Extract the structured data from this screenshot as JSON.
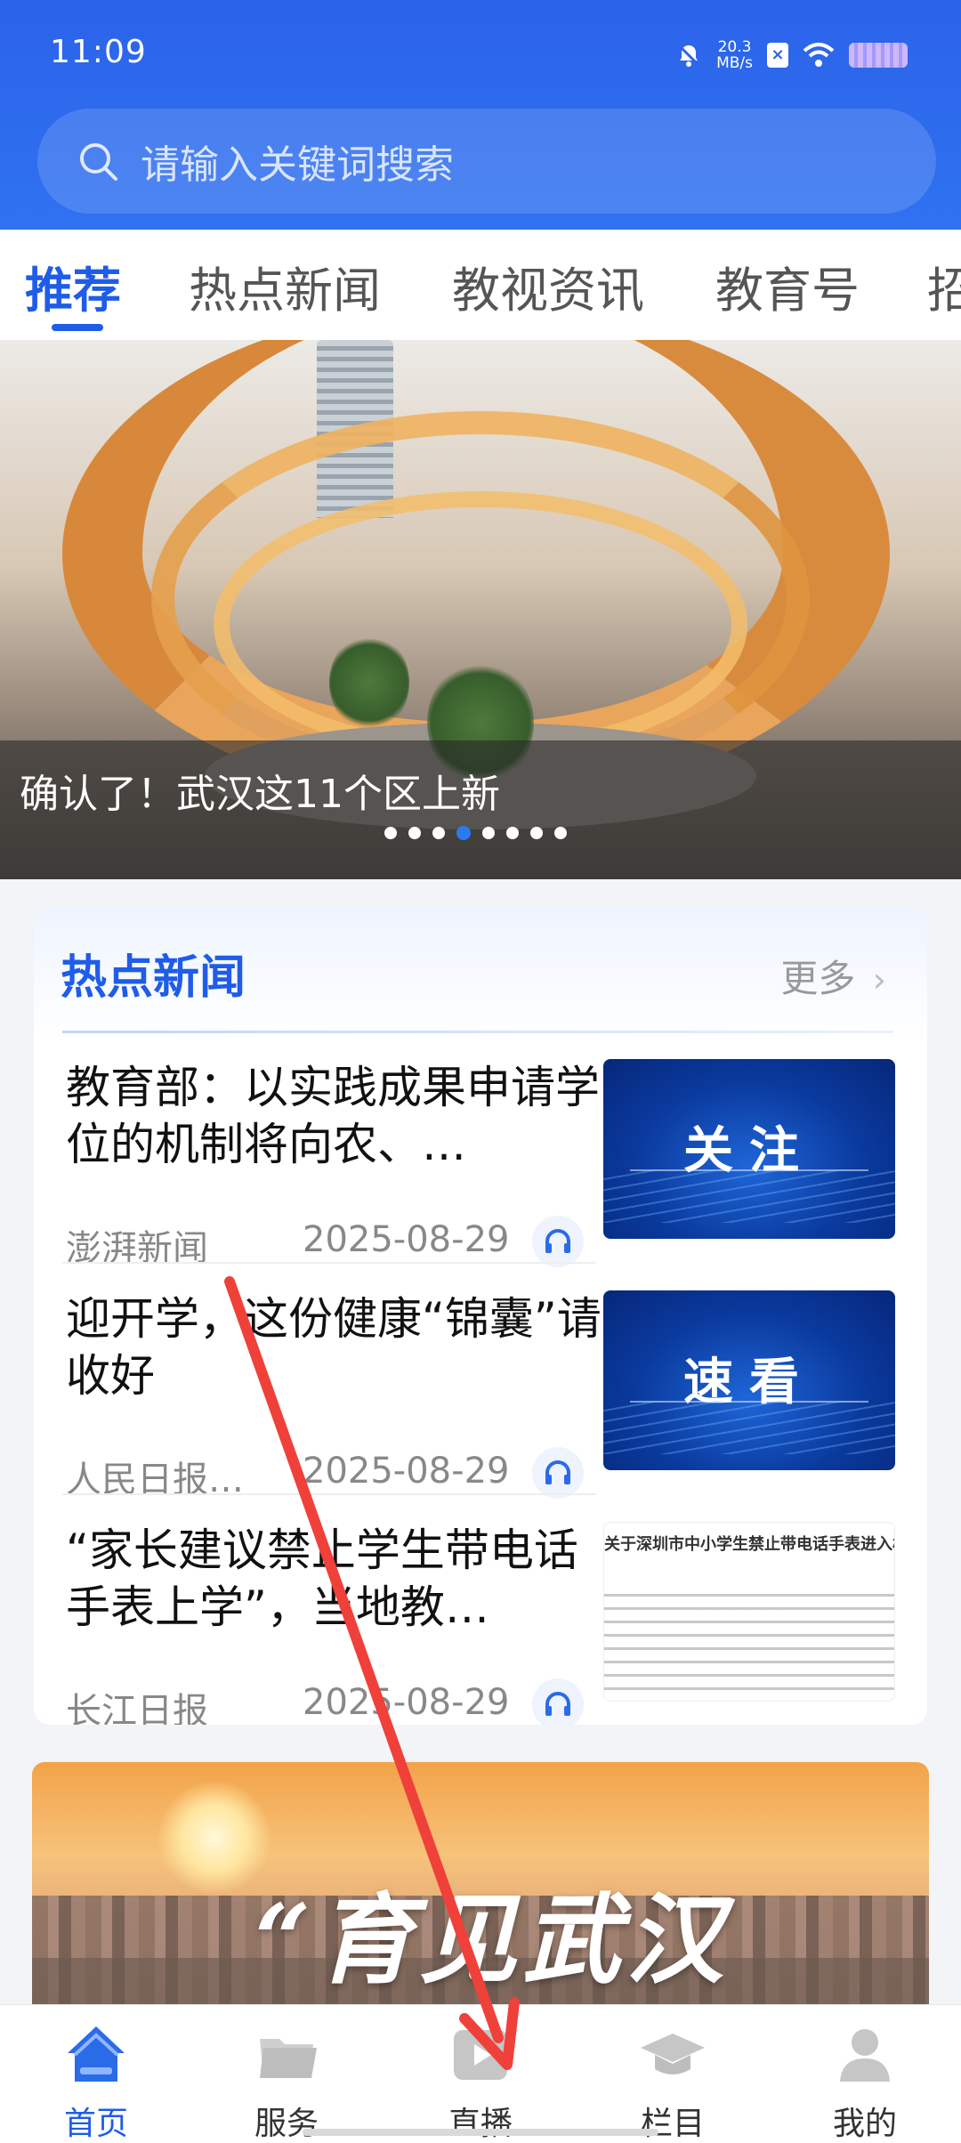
{
  "status_bar": {
    "time": "11:09",
    "net_speed": "20.3\nMB/s",
    "icons": [
      "bell-off-icon",
      "x-app-icon",
      "wifi-icon",
      "battery-icon"
    ]
  },
  "search": {
    "placeholder": "请输入关键词搜索"
  },
  "tabs": [
    {
      "label": "推荐",
      "active": true
    },
    {
      "label": "热点新闻"
    },
    {
      "label": "教视资讯"
    },
    {
      "label": "教育号"
    },
    {
      "label": "招"
    }
  ],
  "banner": {
    "caption": "确认了！武汉这11个区上新",
    "slides": 8,
    "active_slide": 4
  },
  "hot_news": {
    "title": "热点新闻",
    "more": "更多",
    "items": [
      {
        "title": "教育部：以实践成果申请学位的机制将向农、…",
        "source": "澎湃新闻",
        "date": "2025-08-29",
        "thumb_label": "关注"
      },
      {
        "title": "迎开学，这份健康“锦囊”请收好",
        "source": "人民日报…",
        "date": "2025-08-29",
        "thumb_label": "速看"
      },
      {
        "title": "“家长建议禁止学生带电话手表上学”，当地教…",
        "source": "长江日报",
        "date": "2025-08-29",
        "thumb_doc_title": "关于深圳市中小学生禁止带电话手表进入校"
      }
    ]
  },
  "promo": {
    "text": "“育见武汉"
  },
  "bottom_nav": [
    {
      "label": "首页",
      "icon": "home-icon",
      "active": true
    },
    {
      "label": "服务",
      "icon": "folder-icon"
    },
    {
      "label": "直播",
      "icon": "play-icon"
    },
    {
      "label": "栏目",
      "icon": "graduation-cap-icon"
    },
    {
      "label": "我的",
      "icon": "person-icon"
    }
  ],
  "colors": {
    "brand": "#1f5ce8",
    "header": "#2b63ea",
    "annotation": "#f0403a"
  }
}
